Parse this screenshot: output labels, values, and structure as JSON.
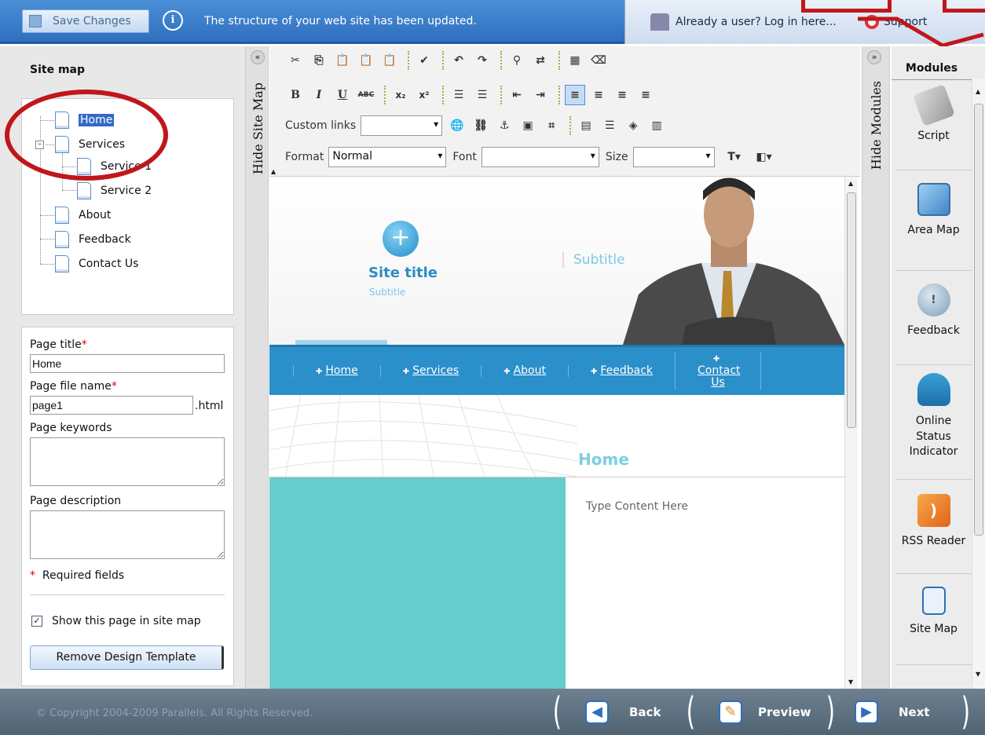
{
  "topbar": {
    "save_label": "Save Changes",
    "status_message": "The structure of your web site has been updated.",
    "login_text": "Already a user? Log in here...",
    "support_text": "Support"
  },
  "sitemap": {
    "title": "Site map",
    "items": [
      {
        "label": "Home",
        "selected": true
      },
      {
        "label": "Services",
        "expanded": true
      },
      {
        "label": "Service 1"
      },
      {
        "label": "Service 2"
      },
      {
        "label": "About"
      },
      {
        "label": "Feedback"
      },
      {
        "label": "Contact Us"
      }
    ],
    "hide_label": "Hide Site Map"
  },
  "page_props": {
    "title_label": "Page title",
    "title_value": "Home",
    "filename_label": "Page file name",
    "filename_value": "page1",
    "filename_ext": ".html",
    "keywords_label": "Page keywords",
    "description_label": "Page description",
    "required_note": "Required fields",
    "required_mark": "*",
    "show_in_sitemap_label": "Show this page in site map",
    "show_in_sitemap": true,
    "remove_template_label": "Remove Design Template"
  },
  "editor": {
    "custom_links_label": "Custom links",
    "format_label": "Format",
    "format_value": "Normal",
    "font_label": "Font",
    "font_value": "",
    "size_label": "Size",
    "size_value": ""
  },
  "site_preview": {
    "site_title": "Site title",
    "site_subtitle": "Subtitle",
    "header_subtitle": "Subtitle",
    "nav": [
      "Home",
      "Services",
      "About",
      "Feedback",
      "Contact Us"
    ],
    "page_heading": "Home",
    "content_placeholder": "Type Content Here",
    "colors": {
      "nav": "#2b8fc9",
      "teal": "#66cccc",
      "accent": "#7ccfe2"
    }
  },
  "modules": {
    "title": "Modules",
    "hide_label": "Hide Modules",
    "items": [
      {
        "label": "Script",
        "icon": "script-icon"
      },
      {
        "label": "Area Map",
        "icon": "area-map-icon"
      },
      {
        "label": "Feedback",
        "icon": "feedback-icon"
      },
      {
        "label": "Online Status Indicator",
        "icon": "online-status-icon"
      },
      {
        "label": "RSS Reader",
        "icon": "rss-icon"
      },
      {
        "label": "Site Map",
        "icon": "site-map-icon"
      }
    ]
  },
  "footer": {
    "copyright": "© Copyright 2004-2009 Parallels. All Rights Reserved.",
    "back_label": "Back",
    "preview_label": "Preview",
    "next_label": "Next"
  }
}
